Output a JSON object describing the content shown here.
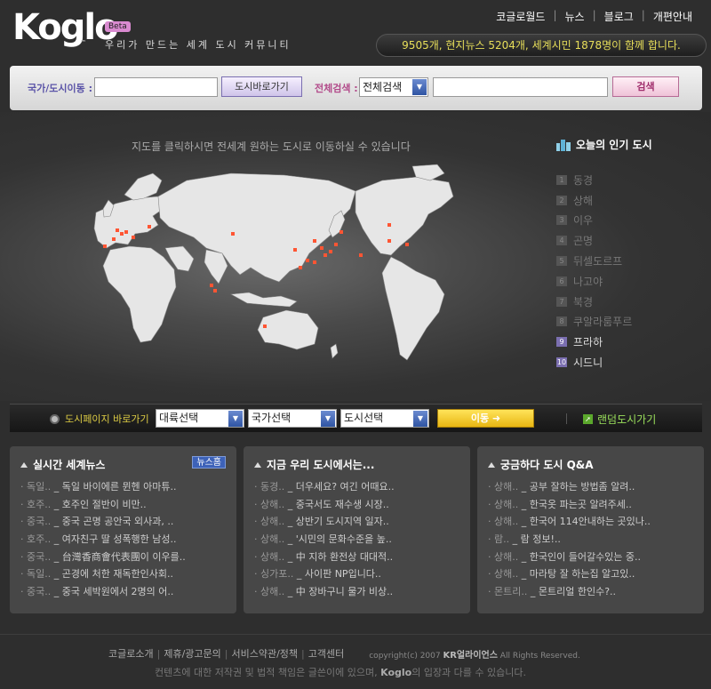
{
  "header": {
    "logo": "Koglo",
    "tm": "™",
    "beta": "Beta",
    "tagline": "우리가 만드는 세계 도시 커뮤니티",
    "links": [
      "코글로월드",
      "뉴스",
      "블로그",
      "개편안내"
    ],
    "stats": "9505개, 현지뉴스 5204개, 세계시민 1878명이 함께 합니다."
  },
  "search": {
    "city_label": "국가/도시이동 :",
    "city_value": "",
    "go_button": "도시바로가기",
    "all_label": "전체검색 :",
    "all_select": "전체검색",
    "query_value": "",
    "search_button": "검색"
  },
  "map": {
    "caption": "지도를 클릭하시면 전세계 원하는 도시로 이동하실 수 있습니다",
    "popular_title": "오늘의 인기 도시",
    "popular": [
      {
        "num": "1",
        "name": "동경",
        "color": "#777777"
      },
      {
        "num": "2",
        "name": "상해",
        "color": "#777777"
      },
      {
        "num": "3",
        "name": "이우",
        "color": "#777777"
      },
      {
        "num": "4",
        "name": "곤명",
        "color": "#777777"
      },
      {
        "num": "5",
        "name": "뒤셀도르프",
        "color": "#777777"
      },
      {
        "num": "6",
        "name": "나고야",
        "color": "#777777"
      },
      {
        "num": "7",
        "name": "북경",
        "color": "#777777"
      },
      {
        "num": "8",
        "name": "쿠알라룸푸르",
        "color": "#777777"
      },
      {
        "num": "9",
        "name": "프라하",
        "color": "#dddddd"
      },
      {
        "num": "10",
        "name": "시드니",
        "color": "#dddddd"
      }
    ]
  },
  "nav": {
    "label": "도시페이지 바로가기",
    "continent": "대륙선택",
    "country": "국가선택",
    "city": "도시선택",
    "move_button": "이동 ➜",
    "random_link": "랜덤도시가기"
  },
  "panels": [
    {
      "title": "실시간 세계뉴스",
      "more": "뉴스홈",
      "items": [
        {
          "pre": "· 독일..",
          "text": " _ 독일 바이에른 뮌헨 아마튜.."
        },
        {
          "pre": "· 호주..",
          "text": " _ 호주인 절반이 비만.."
        },
        {
          "pre": "· 중국..",
          "text": " _ 중국 곤명 공안국 외사과, .."
        },
        {
          "pre": "· 호주..",
          "text": " _ 여자친구 딸 성폭행한 남성.."
        },
        {
          "pre": "· 중국..",
          "text": " _ 台灣香商會代表團이 이우를.."
        },
        {
          "pre": "· 독일..",
          "text": " _ 곤경에 처한 재독한인사회.."
        },
        {
          "pre": "· 중국..",
          "text": " _ 중국 세박원에서 2명의 어.."
        }
      ]
    },
    {
      "title": "지금 우리 도시에서는...",
      "more": "",
      "items": [
        {
          "pre": "· 동경..",
          "text": " _ 더우세요? 여긴 어때요.."
        },
        {
          "pre": "· 상해..",
          "text": " _ 중국서도 재수생 시장.."
        },
        {
          "pre": "· 상해..",
          "text": " _ 상반기 도시지역 일자.."
        },
        {
          "pre": "· 상해..",
          "text": " _ '시민의 문화수준을 높.."
        },
        {
          "pre": "· 상해..",
          "text": " _ 中 지하 환전상 대대적.."
        },
        {
          "pre": "· 싱가포..",
          "text": " _ 사이판 NP입니다.."
        },
        {
          "pre": "· 상해..",
          "text": " _ 中 장바구니 물가 비상.."
        }
      ]
    },
    {
      "title": "궁금하다 도시 Q&A",
      "more": "",
      "items": [
        {
          "pre": "· 상해..",
          "text": " _ 공부 잘하는 방법좀 알려.."
        },
        {
          "pre": "· 상해..",
          "text": " _ 한국옷 파는곳 알려주세.."
        },
        {
          "pre": "· 상해..",
          "text": " _ 한국어 114안내하는 곳있나.."
        },
        {
          "pre": "· 람..",
          "text": " _ 람 정보!.."
        },
        {
          "pre": "· 상해..",
          "text": " _ 한국인이 들어갈수있는 중.."
        },
        {
          "pre": "· 상해..",
          "text": " _ 마라탕 잘 하는집 알고있.."
        },
        {
          "pre": "· 몬트리..",
          "text": " _ 몬트리얼 한인수?.."
        }
      ]
    }
  ],
  "footer": {
    "links": [
      "코글로소개",
      "제휴/광고문의",
      "서비스약관/정책",
      "고객센터"
    ],
    "copyright_pre": "copyright(c) 2007 ",
    "company": "KR얼라이언스",
    "copyright_post": " All Rights Reserved.",
    "notice_pre": "컨텐츠에 대한 저작권 및 법적 책임은 글쓴이에 있으며, ",
    "notice_brand": "Koglo",
    "notice_post": "의 입장과 다를 수 있습니다."
  },
  "colors": {
    "accent_yellow": "#e8df5a",
    "city_dot": "#ff5533",
    "random_green": "#9be15c"
  }
}
